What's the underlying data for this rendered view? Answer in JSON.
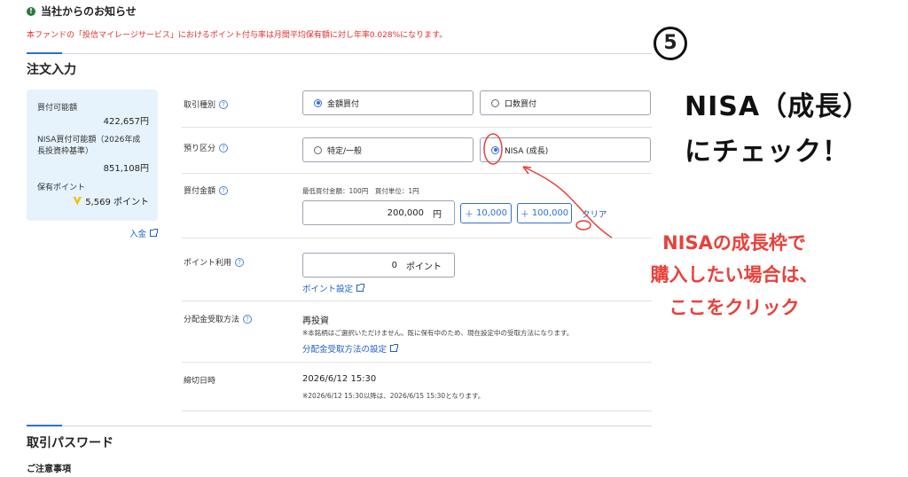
{
  "notice": {
    "title": "当社からのお知らせ",
    "text": "本ファンドの「投信マイレージサービス」におけるポイント付与率は月間平均保有額に対し年率0.028%になります。"
  },
  "order": {
    "title": "注文入力",
    "side": {
      "buying_power_label": "買付可能額",
      "buying_power_value": "422,657円",
      "nisa_label": "NISA買付可能額（2026年成長投資枠基準）",
      "nisa_value": "851,108円",
      "points_label": "保有ポイント",
      "points_value": "5,569 ポイント",
      "deposit_link": "入金"
    },
    "trade_type": {
      "label": "取引種別",
      "opt1": "金額買付",
      "opt2": "口数買付"
    },
    "account": {
      "label": "預り区分",
      "opt1": "特定/一般",
      "opt2": "NISA (成長)"
    },
    "amount": {
      "label": "買付金額",
      "hint": "最低買付金額：100円　買付単位：1円",
      "value": "200,000",
      "unit": "円",
      "btn1": "10,000",
      "btn2": "100,000",
      "clear": "クリア"
    },
    "points": {
      "label": "ポイント利用",
      "value": "0",
      "unit": "ポイント",
      "settings_link": "ポイント設定"
    },
    "dividend": {
      "label": "分配金受取方法",
      "value": "再投資",
      "note": "※本銘柄はご選択いただけません。既に保有中のため、現在設定中の受取方法になります。",
      "link": "分配金受取方法の設定"
    },
    "deadline": {
      "label": "締切日時",
      "value": "2026/6/12 15:30",
      "note": "※2026/6/12 15:30以降は、2026/6/15 15:30となります。"
    }
  },
  "password_section": {
    "title": "取引パスワード"
  },
  "caution": {
    "title": "ご注意事項"
  },
  "annotations": {
    "step": "5",
    "main_line1": "NISA（成長）",
    "main_line2": "にチェック！",
    "red_line1": "NISAの成長枠で",
    "red_line2": "購入したい場合は、",
    "red_line3": "ここをクリック"
  },
  "colors": {
    "accent": "#2c6fd6",
    "alert_red": "#e8413a",
    "side_bg": "#e6f2fc"
  }
}
